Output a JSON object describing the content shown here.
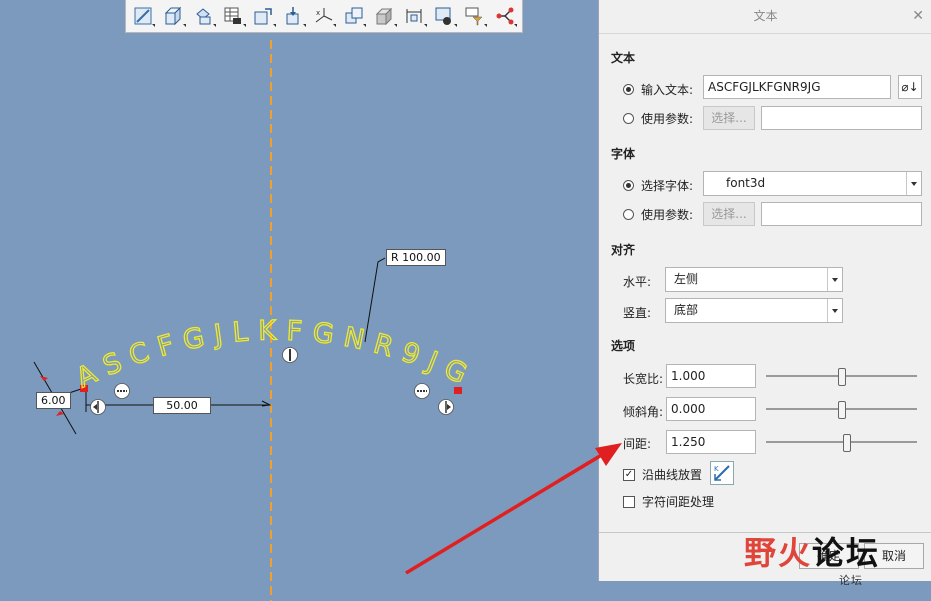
{
  "dimensions": {
    "radius_label": "R 100.00",
    "height_label": "6.00",
    "offset_label": "50.00"
  },
  "curve_text": "ASCFGJLKFGNR9JG",
  "toolbar": {
    "icons": [
      "sketch-plane-icon",
      "box-icon",
      "shapes-icon",
      "table-camera-icon",
      "move-icon",
      "mirror-icon",
      "xyz-icon",
      "copy-icon",
      "solid-icon",
      "dimension-icon",
      "view-icon",
      "filter-icon",
      "branch-icon"
    ]
  },
  "panel": {
    "title": "文本",
    "section_text": "文本",
    "input_text_label": "输入文本:",
    "input_text_value": "ASCFGJLKFGNR9JG",
    "use_param_label": "使用参数:",
    "select_button": "选择...",
    "section_font": "字体",
    "select_font_label": "选择字体:",
    "font_value": "font3d",
    "section_align": "对齐",
    "horizontal_label": "水平:",
    "horizontal_value": "左侧",
    "vertical_label": "竖直:",
    "vertical_value": "底部",
    "section_options": "选项",
    "aspect_label": "长宽比:",
    "aspect_value": "1.000",
    "aspect_level": 0.5,
    "slant_label": "倾斜角:",
    "slant_value": "0.000",
    "slant_level": 0.5,
    "spacing_label": "间距:",
    "spacing_value": "1.250",
    "spacing_level": 0.54,
    "along_curve_label": "沿曲线放置",
    "along_curve_checked": true,
    "char_spacing_label": "字符间距处理",
    "char_spacing_checked": false,
    "ok_button": "确定",
    "cancel_button": "取消"
  },
  "watermark": {
    "part1": "野火",
    "part2": "论坛",
    "sub": "论坛"
  },
  "colors": {
    "canvas_bg": "#7b9abd",
    "curve_text": "#f0ea2a",
    "centerline": "#f0a030",
    "arrow": "#e02020",
    "handle_red": "#e02020"
  }
}
